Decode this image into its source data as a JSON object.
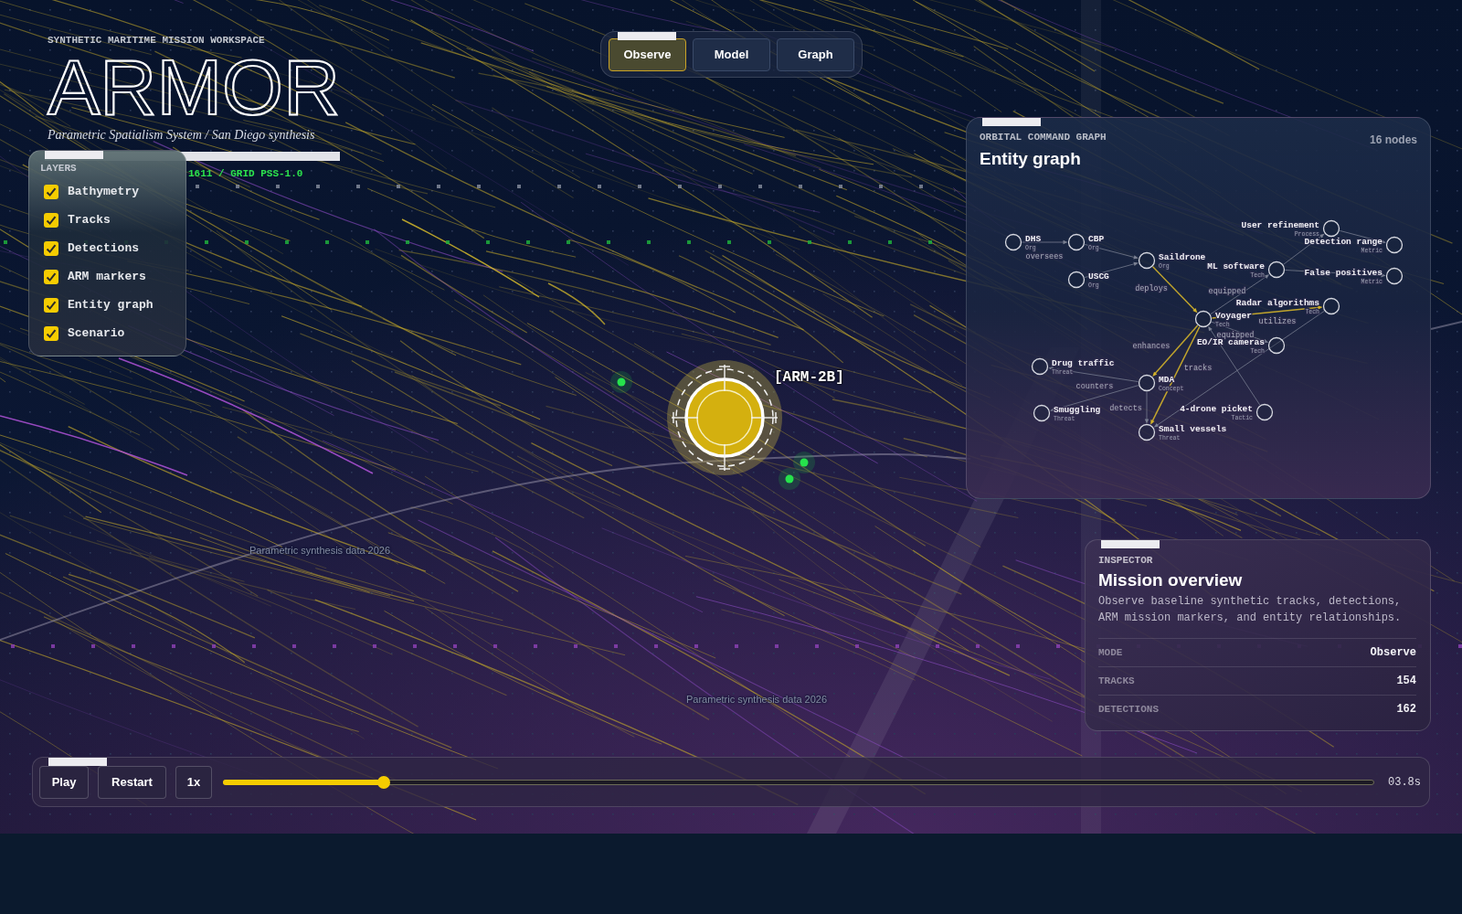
{
  "header": {
    "eyebrow": "SYNTHETIC MARITIME MISSION WORKSPACE",
    "title": "ARMOR",
    "subtitle": "Parametric Spatialism System / San Diego synthesis"
  },
  "mode_tabs": [
    {
      "label": "Observe",
      "selected": true
    },
    {
      "label": "Model",
      "selected": false
    },
    {
      "label": "Graph",
      "selected": false
    }
  ],
  "layers": {
    "title": "LAYERS",
    "items": [
      {
        "label": "Bathymetry",
        "checked": true
      },
      {
        "label": "Tracks",
        "checked": true
      },
      {
        "label": "Detections",
        "checked": true
      },
      {
        "label": "ARM markers",
        "checked": true
      },
      {
        "label": "Entity graph",
        "checked": true
      },
      {
        "label": "Scenario",
        "checked": true
      }
    ]
  },
  "map": {
    "grid_readout": "1611 / GRID PSS-1.0",
    "marker_label": "[ARM-2B]",
    "captions": [
      "Parametric synthesis data 2026",
      "Parametric synthesis data 2026"
    ]
  },
  "entity_graph": {
    "eyebrow": "ORBITAL COMMAND GRAPH",
    "title": "Entity graph",
    "node_count": "16 nodes",
    "nodes": [
      {
        "label": "DHS",
        "category": "Org"
      },
      {
        "label": "CBP",
        "category": "Org"
      },
      {
        "label": "Saildrone",
        "category": "Org"
      },
      {
        "label": "USCG",
        "category": "Org"
      },
      {
        "label": "User refinement",
        "category": "Process"
      },
      {
        "label": "Detection range",
        "category": "Metric"
      },
      {
        "label": "ML software",
        "category": "Tech"
      },
      {
        "label": "False positives",
        "category": "Metric"
      },
      {
        "label": "Radar algorithms",
        "category": "Tech"
      },
      {
        "label": "Voyager",
        "category": "Tech"
      },
      {
        "label": "EO/IR cameras",
        "category": "Tech"
      },
      {
        "label": "Drug traffic",
        "category": "Threat"
      },
      {
        "label": "MDA",
        "category": "Concept"
      },
      {
        "label": "Smuggling",
        "category": "Threat"
      },
      {
        "label": "4-drone picket",
        "category": "Tactic"
      },
      {
        "label": "Small vessels",
        "category": "Threat"
      }
    ],
    "edges": [
      {
        "label": "oversees",
        "highlighted": false
      },
      {
        "highlighted": false
      },
      {
        "highlighted": false
      },
      {
        "label": "deploys",
        "highlighted": true
      },
      {
        "label": "equipped",
        "highlighted": false
      },
      {
        "label": "utilizes",
        "highlighted": true
      },
      {
        "label": "equipped",
        "highlighted": false
      },
      {
        "highlighted": false
      },
      {
        "highlighted": false
      },
      {
        "highlighted": false
      },
      {
        "label": "enhances",
        "highlighted": true
      },
      {
        "label": "tracks",
        "highlighted": true
      },
      {
        "label": "counters",
        "highlighted": false
      },
      {
        "highlighted": false
      },
      {
        "label": "detects",
        "highlighted": false
      },
      {
        "highlighted": false
      },
      {
        "highlighted": false
      }
    ]
  },
  "inspector": {
    "eyebrow": "INSPECTOR",
    "title": "Mission overview",
    "description": "Observe baseline synthetic tracks, detections, ARM mission markers, and entity relationships.",
    "rows": [
      {
        "label": "MODE",
        "value": "Observe"
      },
      {
        "label": "TRACKS",
        "value": "154"
      },
      {
        "label": "DETECTIONS",
        "value": "162"
      }
    ]
  },
  "playback": {
    "buttons": [
      {
        "label": "Play"
      },
      {
        "label": "Restart"
      },
      {
        "label": "1x"
      }
    ],
    "timeline": {
      "level": 0.14
    },
    "time": "03.8s"
  }
}
